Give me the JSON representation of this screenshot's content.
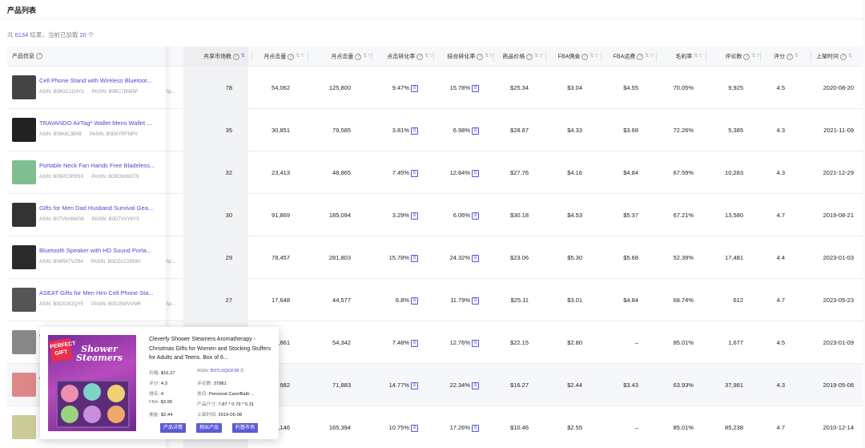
{
  "page": {
    "title": "产品列表",
    "summary_prefix": "共",
    "total": "6134",
    "summary_mid": "结果，当前已加载",
    "loaded": "20",
    "summary_suffix": "个"
  },
  "columns": {
    "product": "产品信息",
    "share": "共享市场数",
    "monthly_units": "月点击量",
    "monthly_sales": "月点击量",
    "click_rate": "点击转化率",
    "conv_rate": "综合转化率",
    "price": "商品价格",
    "fba_fee": "FBA佣金",
    "fba_ship": "FBA运费",
    "margin": "毛利率",
    "reviews": "评论数",
    "rating": "评分",
    "listing": "上架时间"
  },
  "rows": [
    {
      "name": "Cell Phone Stand with Wireless Bluetoot...",
      "asin": "ASIN: B08GC1G4Y3",
      "pasin": "PASIN: B0BC78N65F",
      "sp": "Sp...",
      "share": "78",
      "units": "54,062",
      "sales": "125,800",
      "click": "9.47%",
      "conv": "15.78%",
      "price": "$25.34",
      "fba": "$3.04",
      "ship": "$4.55",
      "margin": "70.05%",
      "reviews": "9,925",
      "rating": "4.5",
      "date": "2020-08-20"
    },
    {
      "name": "TRAVANDO AirTag* Wallet Mens Wallet ...",
      "asin": "ASIN: B09K6L3B49",
      "pasin": "PASIN: B0D6YRFNPV",
      "sp": "",
      "share": "35",
      "units": "30,851",
      "sales": "79,585",
      "click": "3.81%",
      "conv": "6.98%",
      "price": "$28.87",
      "fba": "$4.33",
      "ship": "$3.68",
      "margin": "72.26%",
      "reviews": "5,385",
      "rating": "4.3",
      "date": "2021-11-09"
    },
    {
      "name": "Portable Neck Fan Hands Free Bladeless...",
      "asin": "ASIN: B09PC5R9SX",
      "pasin": "PASIN: B09C9X6GTN",
      "sp": "",
      "share": "32",
      "units": "23,413",
      "sales": "48,865",
      "click": "7.45%",
      "conv": "12.84%",
      "price": "$27.76",
      "fba": "$4.16",
      "ship": "$4.84",
      "margin": "67.59%",
      "reviews": "10,283",
      "rating": "4.3",
      "date": "2021-12-29"
    },
    {
      "name": "Gifts for Men Dad Husband Survival Gea...",
      "asin": "ASIN: B07V6X6MG6",
      "pasin": "PASIN: B0D7VVY6YS",
      "sp": "",
      "share": "30",
      "units": "91,869",
      "sales": "185,094",
      "click": "3.29%",
      "conv": "6.06%",
      "price": "$30.18",
      "fba": "$4.53",
      "ship": "$5.37",
      "margin": "67.21%",
      "reviews": "13,580",
      "rating": "4.7",
      "date": "2019-08-21"
    },
    {
      "name": "Bluetooth Speaker with HD Sound Porta...",
      "asin": "ASIN: B08RK7VZB4",
      "pasin": "PASIN: B0CDLC1RMG",
      "sp": "Sp...",
      "share": "29",
      "units": "78,457",
      "sales": "281,803",
      "click": "15.78%",
      "conv": "24.32%",
      "price": "$23.06",
      "fba": "$5.30",
      "ship": "$5.68",
      "margin": "52.39%",
      "reviews": "17,481",
      "rating": "4.4",
      "date": "2023-01-03"
    },
    {
      "name": "ASEAT Gifts for Men Him Cell Phone Sta...",
      "asin": "ASIN: B0C61K2QY5",
      "pasin": "PASIN: B0D25WVVMR",
      "sp": "Sp...",
      "share": "27",
      "units": "17,648",
      "sales": "44,577",
      "click": "6.8%",
      "conv": "11.79%",
      "price": "$25.11",
      "fba": "$3.01",
      "ship": "$4.84",
      "margin": "68.74%",
      "reviews": "612",
      "rating": "4.7",
      "date": "2023-05-23"
    },
    {
      "name": "C",
      "asin": "",
      "pasin": "",
      "sp": "",
      "share": "",
      "units": ",861",
      "sales": "54,342",
      "click": "7.48%",
      "conv": "12.76%",
      "price": "$22.15",
      "fba": "$2.80",
      "ship": "–",
      "margin": "85.01%",
      "reviews": "1,677",
      "rating": "4.5",
      "date": "2023-01-09"
    },
    {
      "name": "C",
      "asin": "",
      "pasin": "",
      "sp": "",
      "share": "",
      "units": "982",
      "sales": "71,883",
      "click": "14.77%",
      "conv": "22.34%",
      "price": "$16.27",
      "fba": "$2.44",
      "ship": "$3.43",
      "margin": "63.93%",
      "reviews": "37,981",
      "rating": "4.3",
      "date": "2019-05-08"
    },
    {
      "name": "",
      "asin": "",
      "pasin": "",
      "sp": "",
      "share": "",
      "units": ",146",
      "sales": "165,394",
      "click": "10.75%",
      "conv": "17.26%",
      "price": "$10.46",
      "fba": "$2.55",
      "ship": "–",
      "margin": "85.01%",
      "reviews": "85,238",
      "rating": "4.7",
      "date": "2010-12-14"
    }
  ],
  "popup": {
    "title": "Cleverfy Shower Steamers Aromatherapy - Christmas Gifts for Women and Stocking Stuffers for Adults and Teens. Box of 6...",
    "img_badge": "PERFECT GIFT",
    "img_brand": "Shower Steamers",
    "price_k": "价格:",
    "price_v": "$16.27",
    "asin_k": "ASIN:",
    "asin_v": "B07L5QGF38",
    "rating_k": "评分:",
    "rating_v": "4.3",
    "reviews_k": "评论数:",
    "reviews_v": "37981",
    "rank_k": "排名:",
    "rank_v": "4",
    "cat_k": "类目:",
    "cat_v": "Personal Care/Bath ...",
    "fba_k": "FBA:",
    "fba_v": "$3.99",
    "size_k": "产品尺寸:",
    "size_v": "7.87 * 0.79 * 5.31",
    "comm_k": "佣金:",
    "comm_v": "$2.44",
    "date_k": "上架时间:",
    "date_v": "2019-05-08",
    "btn1": "产品详情",
    "btn2": "相似产品",
    "btn3": "利基市场"
  },
  "colors": {
    "accent": "#5b5bd6"
  }
}
